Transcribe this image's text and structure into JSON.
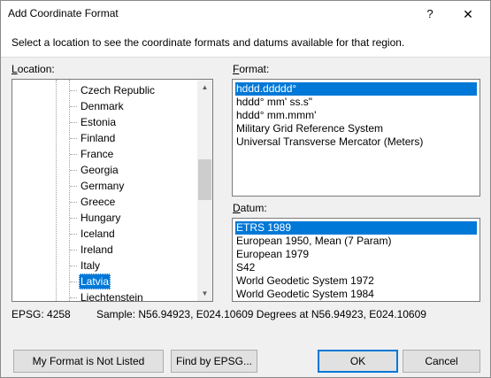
{
  "window": {
    "title": "Add Coordinate Format",
    "help_glyph": "?",
    "close_glyph": "✕"
  },
  "description": "Select a location to see the coordinate formats and datums available for that region.",
  "location": {
    "label": "Location:",
    "items": [
      {
        "label": "Czech Republic",
        "selected": false
      },
      {
        "label": "Denmark",
        "selected": false
      },
      {
        "label": "Estonia",
        "selected": false
      },
      {
        "label": "Finland",
        "selected": false
      },
      {
        "label": "France",
        "selected": false
      },
      {
        "label": "Georgia",
        "selected": false
      },
      {
        "label": "Germany",
        "selected": false
      },
      {
        "label": "Greece",
        "selected": false
      },
      {
        "label": "Hungary",
        "selected": false
      },
      {
        "label": "Iceland",
        "selected": false
      },
      {
        "label": "Ireland",
        "selected": false
      },
      {
        "label": "Italy",
        "selected": false
      },
      {
        "label": "Latvia",
        "selected": true
      },
      {
        "label": "Liechtenstein",
        "selected": false
      }
    ],
    "scroll_up_glyph": "▲",
    "scroll_down_glyph": "▼"
  },
  "format": {
    "label": "Format:",
    "items": [
      {
        "label": "hddd.ddddd°",
        "selected": true
      },
      {
        "label": "hddd° mm' ss.s\"",
        "selected": false
      },
      {
        "label": "hddd° mm.mmm'",
        "selected": false
      },
      {
        "label": "Military Grid Reference System",
        "selected": false
      },
      {
        "label": "Universal Transverse Mercator (Meters)",
        "selected": false
      }
    ]
  },
  "datum": {
    "label": "Datum:",
    "items": [
      {
        "label": "ETRS 1989",
        "selected": true
      },
      {
        "label": "European 1950, Mean (7 Param)",
        "selected": false
      },
      {
        "label": "European 1979",
        "selected": false
      },
      {
        "label": "S42",
        "selected": false
      },
      {
        "label": "World Geodetic System 1972",
        "selected": false
      },
      {
        "label": "World Geodetic System 1984",
        "selected": false
      }
    ]
  },
  "status": {
    "epsg": "EPSG: 4258",
    "sample": "Sample: N56.94923, E024.10609 Degrees at N56.94923, E024.10609"
  },
  "buttons": {
    "not_listed": "My Format is Not Listed",
    "find_epsg": "Find by EPSG...",
    "ok": "OK",
    "cancel": "Cancel"
  },
  "colors": {
    "selection": "#0078d7",
    "dialog_bg": "#f0f0f0"
  }
}
